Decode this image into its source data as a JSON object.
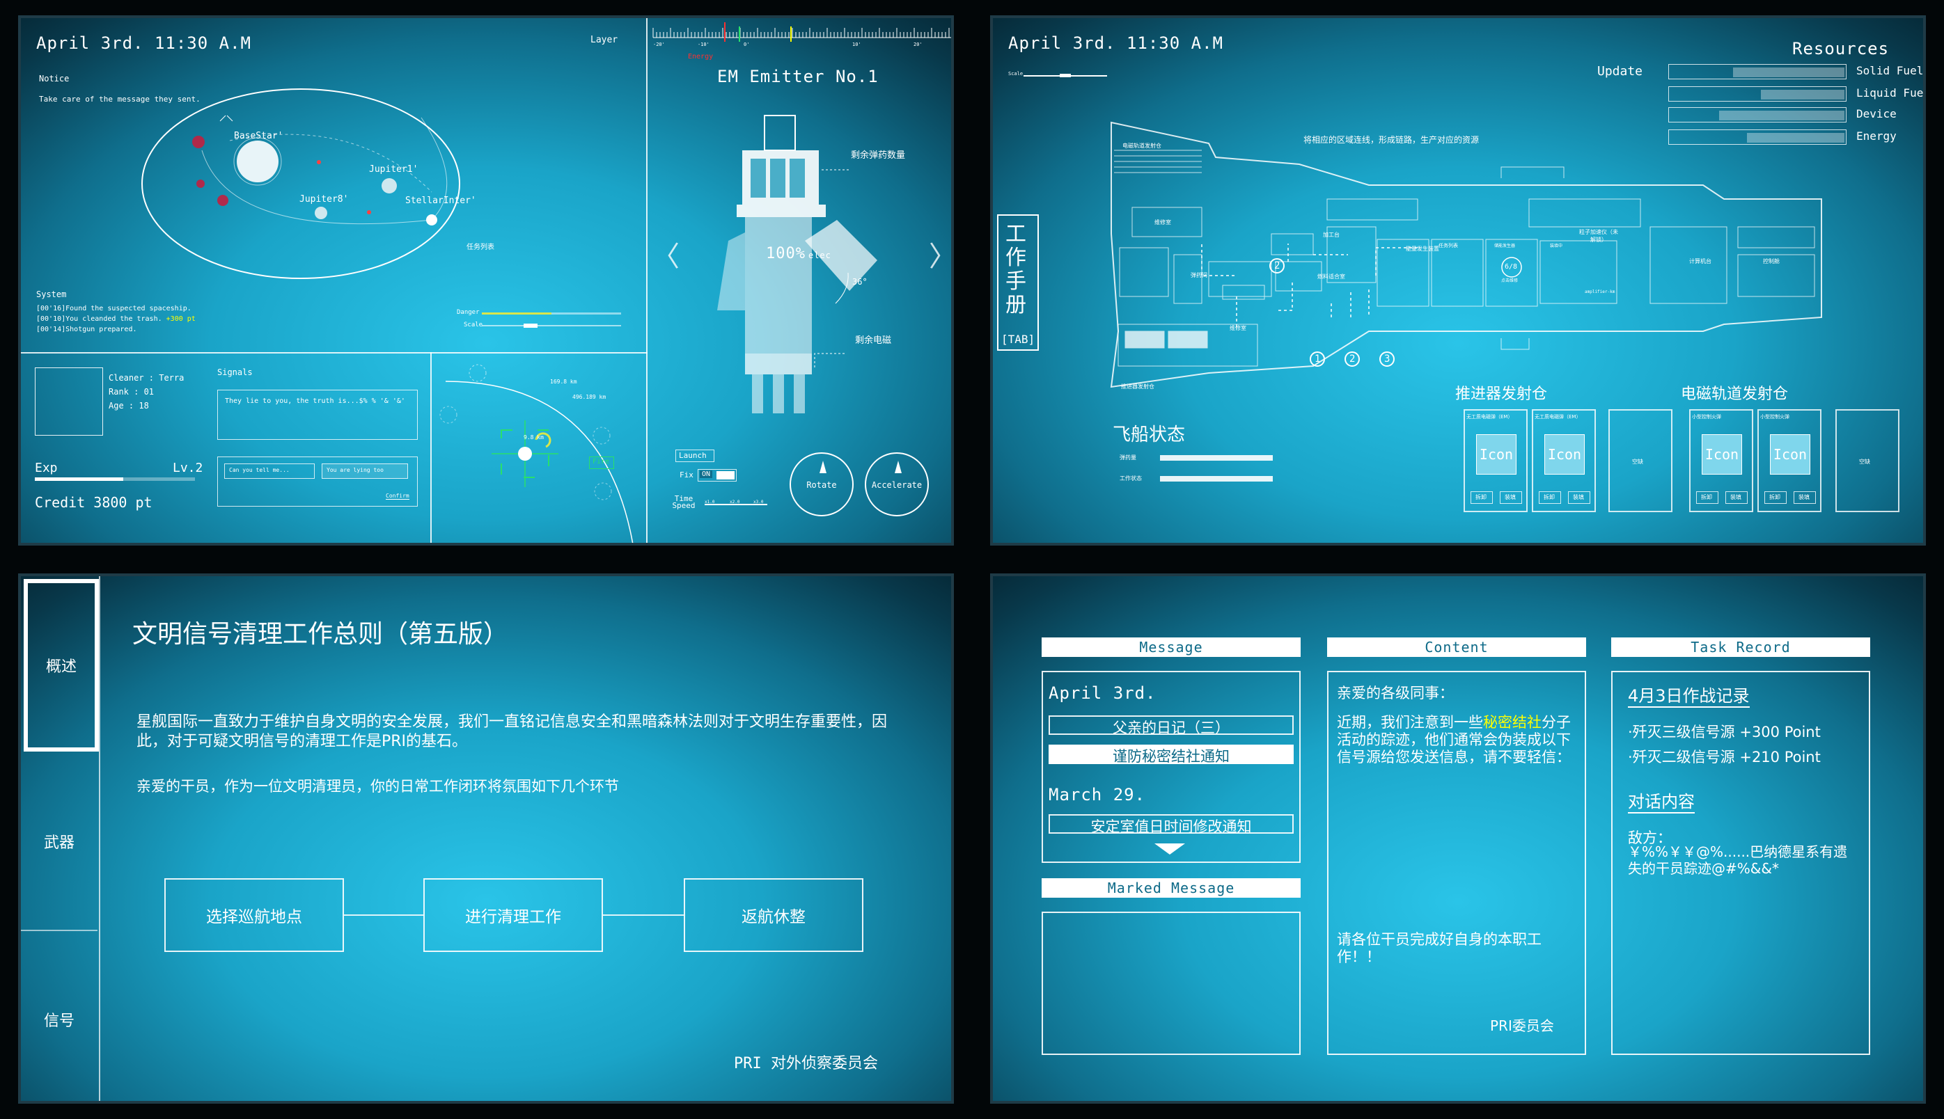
{
  "p1": {
    "datetime": "April 3rd. 11:30 A.M",
    "layer": "Layer",
    "notice_title": "Notice",
    "notice_text": "Take care of the message they sent.",
    "star_labels": [
      "BaseStar'",
      "Jupiter1'",
      "Jupiter8'",
      "StellarInter'"
    ],
    "orbit_tag": "任务列表",
    "system_title": "System",
    "system_logs": [
      "[00'16]Found the suspected spaceship.",
      "[00'10]You cleanded the trash.",
      "[00'14]Shotgun prepared."
    ],
    "reward_text": "+300 pt",
    "danger": "Danger",
    "danger_level": 0.5,
    "scale": "Scale",
    "pilot_name": "Cleaner : Terra",
    "pilot_rank": "Rank : 01",
    "pilot_age": "Age : 18",
    "exp_label": "Exp",
    "level": "Lv.2",
    "exp_progress": 0.55,
    "credit": "Credit  3800 pt",
    "signals_title": "Signals",
    "signal_msg": "They lie to you, the truth is...$% % '& '&'",
    "reply_input_placeholder": "Can you tell me...",
    "reply_input2_placeholder": "You are lying too",
    "confirm": "Confirm",
    "radar_dist1": "169.8 km",
    "radar_dist2": "496.189 km",
    "radar_dist3": "9.8 km",
    "fire": "Fire",
    "ruler_ticks": [
      "-20'",
      "-10'",
      "0'",
      "10'",
      "20'"
    ],
    "energy_tag": "Energy",
    "emitter_title": "EM Emitter No.1",
    "ammo_label": "剩余弹药数量",
    "percent": "100%",
    "percent_unit": "elec",
    "angle": "36°",
    "power_label": "剩余电磁",
    "launch": "Launch",
    "fix": "Fix",
    "fix_state": "ON",
    "time_speed": "Time Speed",
    "speed_ticks": [
      "x1.0",
      "x2.0",
      "x3.0"
    ],
    "rotate": "Rotate",
    "accelerate": "Accelerate"
  },
  "p2": {
    "datetime": "April 3rd. 11:30 A.M",
    "scale": "Scale",
    "update": "Update",
    "resources_title": "Resources",
    "resources": [
      {
        "name": "Solid Fuel",
        "level": 0.64
      },
      {
        "name": "Liquid Fuel",
        "level": 0.48
      },
      {
        "name": "Device",
        "level": 0.72
      },
      {
        "name": "Energy",
        "level": 0.56
      }
    ],
    "hint": "将相应的区域连线，形成链路，生产对应的资源",
    "manual_tab": "工作手册",
    "tab_key": "[TAB]",
    "rooms": [
      "电磁轨道发射仓",
      "维修室",
      "加工台",
      "能量发生装置",
      "任务列表",
      "粒子加速仪（未解锁）",
      "计算机台",
      "控制舱",
      "弹药间",
      "燃料适合室",
      "维修室",
      "推进器发射仓",
      "6/8"
    ],
    "room_sub": [
      "储能发生器",
      "点击维修",
      "装填中",
      "amplifier-km"
    ],
    "markers": [
      "1",
      "2",
      "3",
      "2"
    ],
    "ship_status": "飞船状态",
    "status_labels": [
      "弹药量",
      "工作状态"
    ],
    "thruster_title": "推进器发射仓",
    "railgun_title": "电磁轨道发射仓",
    "thruster_slots": [
      {
        "name": "无工质电磁弹（EM）",
        "icon": "Icon",
        "b1": "拆卸",
        "b2": "装填"
      },
      {
        "name": "无工质电磁弹（EM）",
        "icon": "Icon",
        "b1": "拆卸",
        "b2": "装填"
      }
    ],
    "railgun_slots": [
      {
        "name": "小型控制火弹",
        "icon": "Icon",
        "b1": "拆卸",
        "b2": "装填"
      },
      {
        "name": "小型控制火弹",
        "icon": "Icon",
        "b1": "拆卸",
        "b2": "装填"
      }
    ],
    "empty_slot": "空缺"
  },
  "p3": {
    "tabs": [
      "概述",
      "武器",
      "信号"
    ],
    "title": "文明信号清理工作总则（第五版）",
    "para1": "星舰国际一直致力于维护自身文明的安全发展，我们一直铭记信息安全和黑暗森林法则对于文明生存重要性，因此，对于可疑文明信号的清理工作是PRI的基石。",
    "para2": "亲爱的干员，作为一位文明清理员，你的日常工作闭环将氛围如下几个环节",
    "flow": [
      "选择巡航地点",
      "进行清理工作",
      "返航休整"
    ],
    "footer": "PRI 对外侦察委员会"
  },
  "p4": {
    "message_hdr": "Message",
    "content_hdr": "Content",
    "task_hdr": "Task Record",
    "marked_hdr": "Marked Message",
    "date1": "April 3rd.",
    "msg1": "父亲的日记（三）",
    "msg2": "谨防秘密结社通知",
    "date2": "March 29.",
    "msg3": "安定室值日时间修改通知",
    "greeting": "亲爱的各级同事：",
    "body_pre": "近期，我们注意到一些",
    "body_hl": "秘密结社",
    "body_post": "分子活动的踪迹，他们通常会伪装成以下信号源给您发送信息，请不要轻信：",
    "closing": "请各位干员完成好自身的本职工作！！",
    "signature": "PRI委员会",
    "task_title": "4月3日作战记录",
    "task_items": [
      "·歼灭三级信号源 +300 Point",
      "·歼灭二级信号源 +210 Point"
    ],
    "dialog_title": "对话内容",
    "dialog_who": "敌方：",
    "dialog_text": "￥%%￥￥@%......巴纳德星系有遗失的干员踪迹@#%&&*"
  },
  "colors": {
    "accent": "#ffff00",
    "panel_center": "#2ac4e8",
    "panel_edge": "#05222e",
    "header_text": "#0d6a88",
    "radar_green": "#29e06b"
  }
}
